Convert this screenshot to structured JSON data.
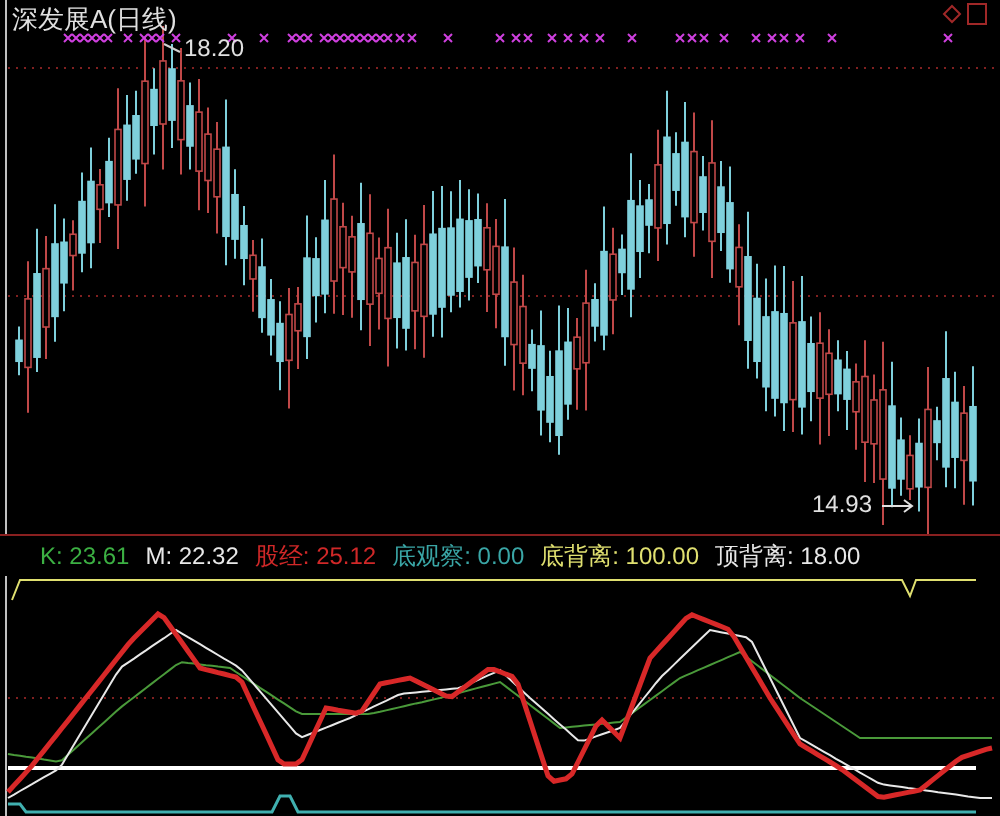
{
  "chart": {
    "title": "深发展A(日线)",
    "high_label": "18.20",
    "low_label": "14.93"
  },
  "legend": [
    {
      "text": "K: 23.61",
      "color": "#3cb043"
    },
    {
      "text": "M: 22.32",
      "color": "#e8e8e8"
    },
    {
      "text": "股经: 25.12",
      "color": "#d02828"
    },
    {
      "text": "底观察: 0.00",
      "color": "#3aa6a6"
    },
    {
      "text": "底背离: 100.00",
      "color": "#e0e070"
    },
    {
      "text": "顶背离: 18.00",
      "color": "#e8e8e8"
    }
  ]
}
